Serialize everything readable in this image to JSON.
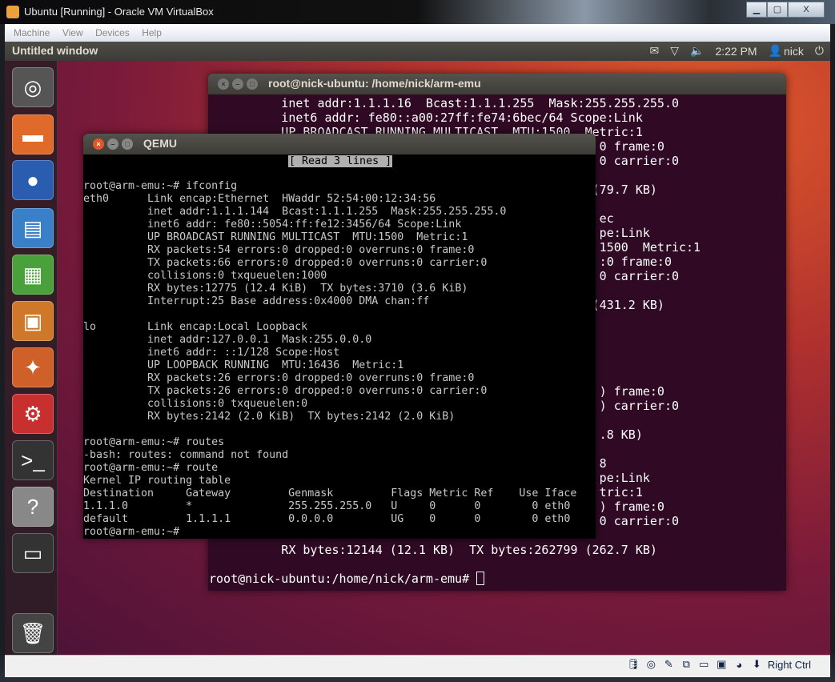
{
  "host_window": {
    "title": "Ubuntu [Running] - Oracle VM VirtualBox",
    "buttons": [
      "▁",
      "▢",
      "X"
    ]
  },
  "menu": [
    "Machine",
    "View",
    "Devices",
    "Help"
  ],
  "panel": {
    "title": "Untitled window",
    "time": "2:22 PM",
    "user": "nick"
  },
  "launcher": [
    {
      "name": "ubuntu-dash",
      "glyph": "◎",
      "color": "#555"
    },
    {
      "name": "files",
      "glyph": "▬",
      "color": "#e06a2a"
    },
    {
      "name": "firefox",
      "glyph": "●",
      "color": "#2a5db0"
    },
    {
      "name": "writer",
      "glyph": "▤",
      "color": "#3a80c8"
    },
    {
      "name": "calc",
      "glyph": "▦",
      "color": "#4aa03a"
    },
    {
      "name": "impress",
      "glyph": "▣",
      "color": "#d0782a"
    },
    {
      "name": "software-center",
      "glyph": "✦",
      "color": "#d0602a"
    },
    {
      "name": "system-settings",
      "glyph": "⚙",
      "color": "#c83030"
    },
    {
      "name": "terminal",
      "glyph": ">_",
      "color": "#333"
    },
    {
      "name": "help",
      "glyph": "?",
      "color": "#888"
    },
    {
      "name": "workspace-switcher",
      "glyph": "▭",
      "color": "#333"
    },
    {
      "name": "trash",
      "glyph": "🗑",
      "color": "#444"
    }
  ],
  "terminal": {
    "title": "root@nick-ubuntu: /home/nick/arm-emu",
    "lines": [
      "          inet addr:1.1.1.16  Bcast:1.1.1.255  Mask:255.255.255.0",
      "          inet6 addr: fe80::a00:27ff:fe74:6bec/64 Scope:Link",
      "          UP BROADCAST RUNNING MULTICAST  MTU:1500  Metric:1",
      "                                                      0 frame:0",
      "                                                      0 carrier:0",
      "",
      "                                                     (79.7 KB)",
      "",
      "                                                      ec",
      "                                                      pe:Link",
      "                                                      1500  Metric:1",
      "                                                      :0 frame:0",
      "                                                      0 carrier:0",
      "",
      "                                                     (431.2 KB)",
      "",
      "",
      "",
      "",
      "",
      "                                                      ) frame:0",
      "                                                      ) carrier:0",
      "",
      "                                                      .8 KB)",
      "",
      "                                                      8",
      "                                                      pe:Link",
      "                                                      tric:1",
      "                                                      ) frame:0",
      "                                                      0 carrier:0",
      "",
      "          RX bytes:12144 (12.1 KB)  TX bytes:262799 (262.7 KB)",
      ""
    ],
    "prompt": "root@nick-ubuntu:/home/nick/arm-emu# "
  },
  "qemu": {
    "title": "QEMU",
    "status_msg": "[ Read 3 lines ]",
    "lines": [
      "",
      "",
      "root@arm-emu:~# ifconfig",
      "eth0      Link encap:Ethernet  HWaddr 52:54:00:12:34:56",
      "          inet addr:1.1.1.144  Bcast:1.1.1.255  Mask:255.255.255.0",
      "          inet6 addr: fe80::5054:ff:fe12:3456/64 Scope:Link",
      "          UP BROADCAST RUNNING MULTICAST  MTU:1500  Metric:1",
      "          RX packets:54 errors:0 dropped:0 overruns:0 frame:0",
      "          TX packets:66 errors:0 dropped:0 overruns:0 carrier:0",
      "          collisions:0 txqueuelen:1000",
      "          RX bytes:12775 (12.4 KiB)  TX bytes:3710 (3.6 KiB)",
      "          Interrupt:25 Base address:0x4000 DMA chan:ff",
      "",
      "lo        Link encap:Local Loopback",
      "          inet addr:127.0.0.1  Mask:255.0.0.0",
      "          inet6 addr: ::1/128 Scope:Host",
      "          UP LOOPBACK RUNNING  MTU:16436  Metric:1",
      "          RX packets:26 errors:0 dropped:0 overruns:0 frame:0",
      "          TX packets:26 errors:0 dropped:0 overruns:0 carrier:0",
      "          collisions:0 txqueuelen:0",
      "          RX bytes:2142 (2.0 KiB)  TX bytes:2142 (2.0 KiB)",
      "",
      "root@arm-emu:~# routes",
      "-bash: routes: command not found",
      "root@arm-emu:~# route",
      "Kernel IP routing table",
      "Destination     Gateway         Genmask         Flags Metric Ref    Use Iface",
      "1.1.1.0         *               255.255.255.0   U     0      0        0 eth0",
      "default         1.1.1.1         0.0.0.0         UG    0      0        0 eth0",
      "root@arm-emu:~#"
    ]
  },
  "statusbar": {
    "host_key": "Right Ctrl",
    "icons": [
      "hard-disk-icon",
      "optical-drive-icon",
      "usb-icon",
      "network-icon",
      "shared-folder-icon",
      "virtualization-icon",
      "mouse-integration-icon",
      "keyboard-capture-icon"
    ]
  }
}
